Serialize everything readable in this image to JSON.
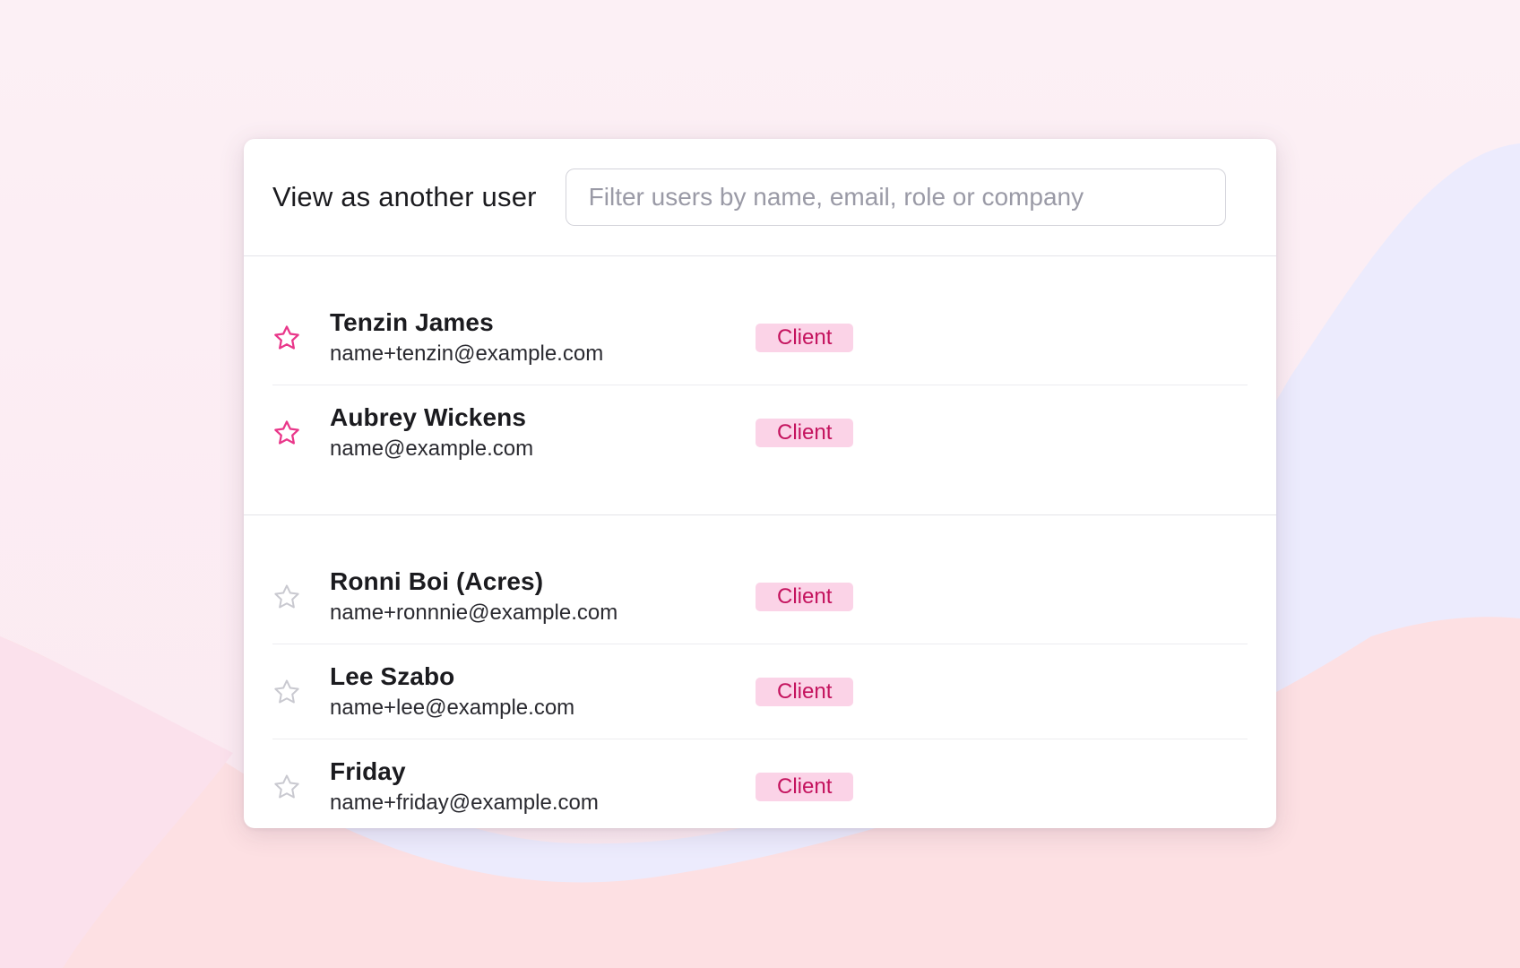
{
  "dialog": {
    "title": "View as another user",
    "search": {
      "placeholder": "Filter users by name, email, role or company",
      "value": ""
    }
  },
  "colors": {
    "accent": "#e9378a",
    "badge_bg": "#fbd3e7",
    "badge_text": "#c4135e",
    "star_inactive": "#c9c9d0"
  },
  "favorites": [
    {
      "name": "Tenzin James",
      "email": "name+tenzin@example.com",
      "role": "Client",
      "starred": true,
      "icon": "star-filled-outline-icon"
    },
    {
      "name": "Aubrey Wickens",
      "email": "name@example.com",
      "role": "Client",
      "starred": true,
      "icon": "star-filled-outline-icon"
    }
  ],
  "users": [
    {
      "name": "Ronni Boi (Acres)",
      "email": "name+ronnnie@example.com",
      "role": "Client",
      "starred": false,
      "icon": "star-outline-icon"
    },
    {
      "name": "Lee Szabo",
      "email": "name+lee@example.com",
      "role": "Client",
      "starred": false,
      "icon": "star-outline-icon"
    },
    {
      "name": "Friday",
      "email": "name+friday@example.com",
      "role": "Client",
      "starred": false,
      "icon": "star-outline-icon"
    }
  ]
}
